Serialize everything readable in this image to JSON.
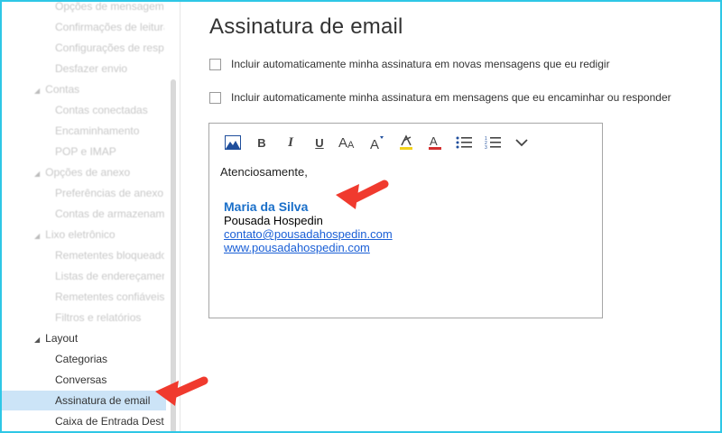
{
  "sidebar": {
    "items": [
      {
        "label": "Opções de mensagem",
        "kind": "sub",
        "faded": true
      },
      {
        "label": "Confirmações de leitura",
        "kind": "sub",
        "faded": true
      },
      {
        "label": "Configurações de resposta",
        "kind": "sub",
        "faded": true
      },
      {
        "label": "Desfazer envio",
        "kind": "sub",
        "faded": true
      },
      {
        "label": "Contas",
        "kind": "group",
        "faded": true
      },
      {
        "label": "Contas conectadas",
        "kind": "sub",
        "faded": true
      },
      {
        "label": "Encaminhamento",
        "kind": "sub",
        "faded": true
      },
      {
        "label": "POP e IMAP",
        "kind": "sub",
        "faded": true
      },
      {
        "label": "Opções de anexo",
        "kind": "group",
        "faded": true
      },
      {
        "label": "Preferências de anexo",
        "kind": "sub",
        "faded": true
      },
      {
        "label": "Contas de armazenamento",
        "kind": "sub",
        "faded": true
      },
      {
        "label": "Lixo eletrônico",
        "kind": "group",
        "faded": true
      },
      {
        "label": "Remetentes bloqueados",
        "kind": "sub",
        "faded": true
      },
      {
        "label": "Listas de endereçamento",
        "kind": "sub",
        "faded": true
      },
      {
        "label": "Remetentes confiáveis",
        "kind": "sub",
        "faded": true
      },
      {
        "label": "Filtros e relatórios",
        "kind": "sub",
        "faded": true
      },
      {
        "label": "Layout",
        "kind": "group",
        "faded": false
      },
      {
        "label": "Categorias",
        "kind": "sub",
        "faded": false
      },
      {
        "label": "Conversas",
        "kind": "sub",
        "faded": false
      },
      {
        "label": "Assinatura de email",
        "kind": "sub",
        "faded": false,
        "selected": true
      },
      {
        "label": "Caixa de Entrada Destaques",
        "kind": "sub",
        "faded": false
      }
    ]
  },
  "main": {
    "title": "Assinatura de email",
    "option_new": "Incluir automaticamente minha assinatura em novas mensagens que eu redigir",
    "option_reply": "Incluir automaticamente minha assinatura em mensagens que eu encaminhar ou responder"
  },
  "toolbar": {
    "bold": "B",
    "italic": "I",
    "underline": "U"
  },
  "editor": {
    "greeting": "Atenciosamente,",
    "signature": {
      "name": "Maria da Silva",
      "company": "Pousada Hospedin",
      "email": "contato@pousadahospedin.com",
      "website": "www.pousadahospedin.com"
    }
  },
  "colors": {
    "accent_frame": "#2ec7e6",
    "selected_bg": "#cce4f7",
    "arrow": "#f03a2e",
    "signature_name": "#1a6fc9",
    "link": "#1a5fd6"
  }
}
